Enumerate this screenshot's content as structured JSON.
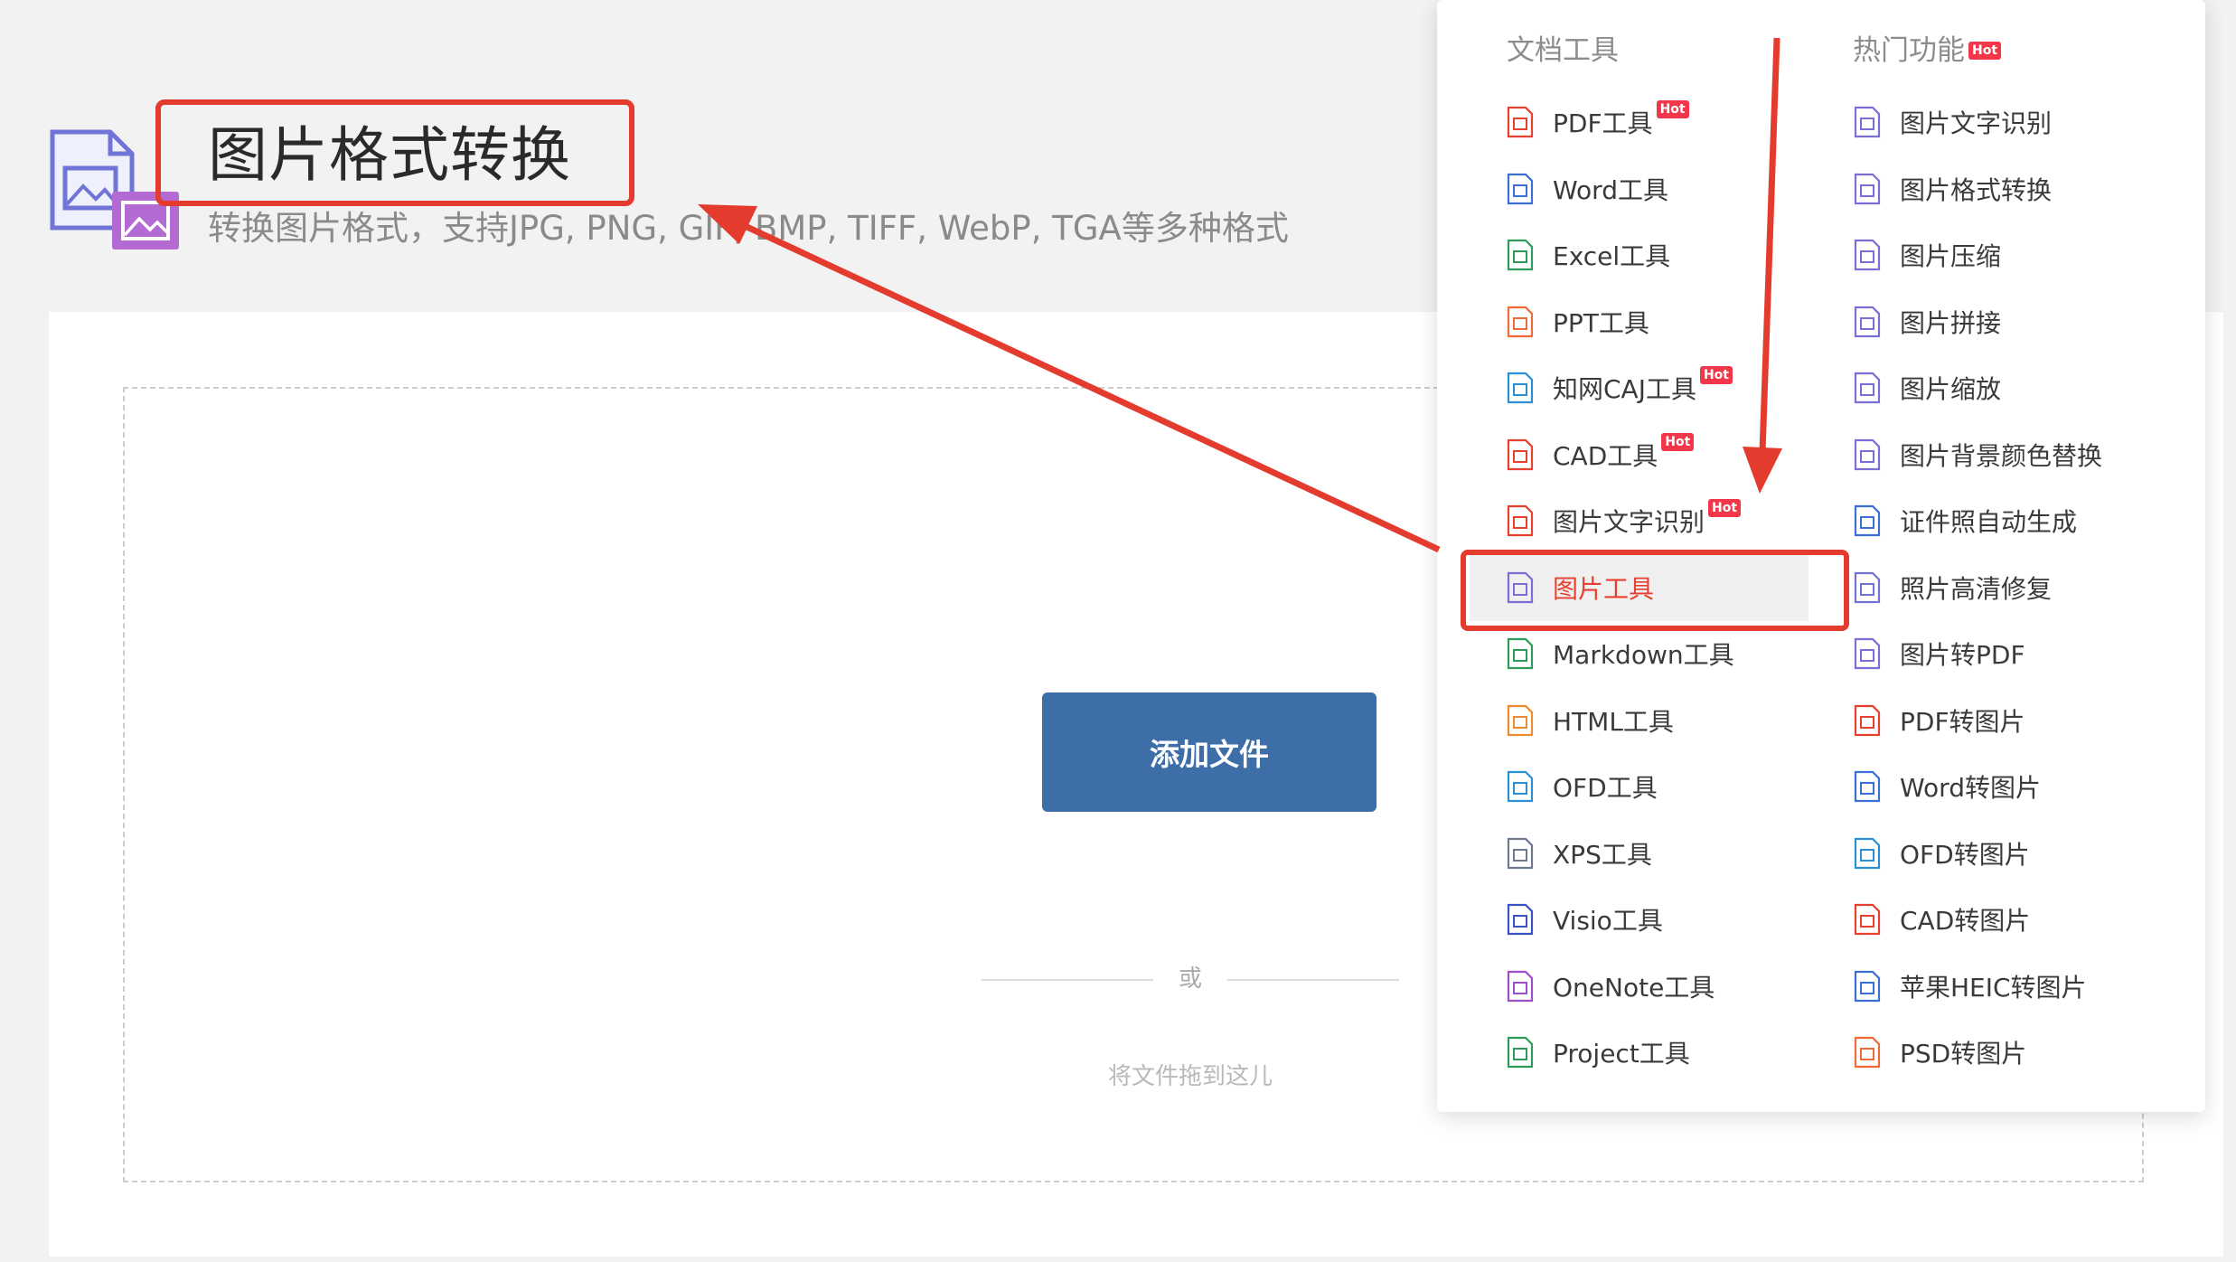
{
  "header": {
    "title": "图片格式转换",
    "subtitle": "转换图片格式，支持JPG, PNG, GIF, BMP, TIFF, WebP, TGA等多种格式"
  },
  "upload": {
    "add_button": "添加文件",
    "or_text": "或",
    "drop_hint": "将文件拖到这儿"
  },
  "menu": {
    "col1_title": "文档工具",
    "col2_title": "热门功能",
    "hot_badge": "Hot",
    "col1_items": [
      {
        "label": "PDF工具",
        "hot": true,
        "icon": "pdf-icon"
      },
      {
        "label": "Word工具",
        "hot": false,
        "icon": "word-icon"
      },
      {
        "label": "Excel工具",
        "hot": false,
        "icon": "excel-icon"
      },
      {
        "label": "PPT工具",
        "hot": false,
        "icon": "ppt-icon"
      },
      {
        "label": "知网CAJ工具",
        "hot": true,
        "icon": "caj-icon"
      },
      {
        "label": "CAD工具",
        "hot": true,
        "icon": "cad-icon"
      },
      {
        "label": "图片文字识别",
        "hot": true,
        "icon": "ocr-icon"
      },
      {
        "label": "图片工具",
        "hot": false,
        "active": true,
        "icon": "image-tool-icon"
      },
      {
        "label": "Markdown工具",
        "hot": false,
        "icon": "markdown-icon"
      },
      {
        "label": "HTML工具",
        "hot": false,
        "icon": "html-icon"
      },
      {
        "label": "OFD工具",
        "hot": false,
        "icon": "ofd-icon"
      },
      {
        "label": "XPS工具",
        "hot": false,
        "icon": "xps-icon"
      },
      {
        "label": "Visio工具",
        "hot": false,
        "icon": "visio-icon"
      },
      {
        "label": "OneNote工具",
        "hot": false,
        "icon": "onenote-icon"
      },
      {
        "label": "Project工具",
        "hot": false,
        "icon": "project-icon"
      }
    ],
    "col2_items": [
      {
        "label": "图片文字识别",
        "icon": "image-ocr-icon"
      },
      {
        "label": "图片格式转换",
        "icon": "image-convert-icon"
      },
      {
        "label": "图片压缩",
        "icon": "image-compress-icon"
      },
      {
        "label": "图片拼接",
        "icon": "image-stitch-icon"
      },
      {
        "label": "图片缩放",
        "icon": "image-resize-icon"
      },
      {
        "label": "图片背景颜色替换",
        "icon": "image-background-icon"
      },
      {
        "label": "证件照自动生成",
        "icon": "id-photo-icon"
      },
      {
        "label": "照片高清修复",
        "icon": "hd-restore-icon"
      },
      {
        "label": "图片转PDF",
        "icon": "image-to-pdf-icon"
      },
      {
        "label": "PDF转图片",
        "icon": "pdf-to-image-icon"
      },
      {
        "label": "Word转图片",
        "icon": "word-to-image-icon"
      },
      {
        "label": "OFD转图片",
        "icon": "ofd-to-image-icon"
      },
      {
        "label": "CAD转图片",
        "icon": "cad-to-image-icon"
      },
      {
        "label": "苹果HEIC转图片",
        "icon": "heic-to-image-icon"
      },
      {
        "label": "PSD转图片",
        "icon": "psd-to-image-icon"
      }
    ]
  },
  "colors": {
    "accent_red": "#e8402f",
    "button_blue": "#3e6ea8",
    "hot_red": "#f2374b",
    "annotation_red": "#e33b2e"
  }
}
